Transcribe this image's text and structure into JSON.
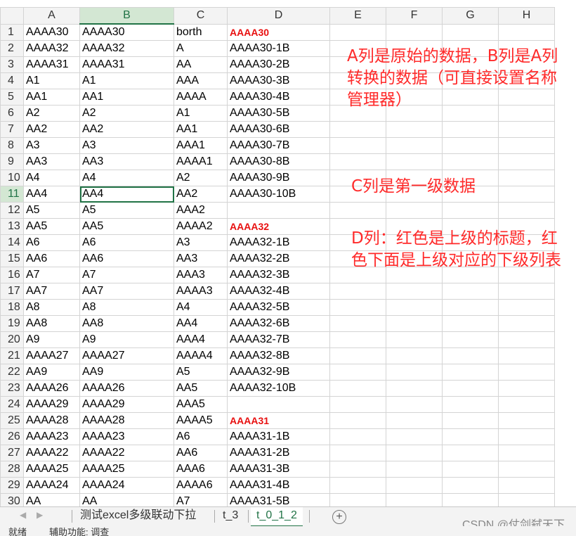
{
  "columns": [
    "A",
    "B",
    "C",
    "D",
    "E",
    "F",
    "G",
    "H"
  ],
  "rows": [
    {
      "num": "1",
      "a": "AAAA30",
      "b": "AAAA30",
      "c": "borth",
      "d": "AAAA30",
      "d_red": true
    },
    {
      "num": "2",
      "a": "AAAA32",
      "b": "AAAA32",
      "c": "A",
      "d": "AAAA30-1B"
    },
    {
      "num": "3",
      "a": "AAAA31",
      "b": "AAAA31",
      "c": "AA",
      "d": "AAAA30-2B"
    },
    {
      "num": "4",
      "a": "A1",
      "b": "A1",
      "c": "AAA",
      "d": "AAAA30-3B"
    },
    {
      "num": "5",
      "a": "AA1",
      "b": "AA1",
      "c": "AAAA",
      "d": "AAAA30-4B"
    },
    {
      "num": "6",
      "a": "A2",
      "b": "A2",
      "c": "A1",
      "d": "AAAA30-5B"
    },
    {
      "num": "7",
      "a": "AA2",
      "b": "AA2",
      "c": "AA1",
      "d": "AAAA30-6B"
    },
    {
      "num": "8",
      "a": "A3",
      "b": "A3",
      "c": "AAA1",
      "d": "AAAA30-7B"
    },
    {
      "num": "9",
      "a": "AA3",
      "b": "AA3",
      "c": "AAAA1",
      "d": "AAAA30-8B"
    },
    {
      "num": "10",
      "a": "A4",
      "b": "A4",
      "c": "A2",
      "d": "AAAA30-9B"
    },
    {
      "num": "11",
      "a": "AA4",
      "b": "AA4",
      "c": "AA2",
      "d": "AAAA30-10B",
      "active": true
    },
    {
      "num": "12",
      "a": "A5",
      "b": "A5",
      "c": "AAA2",
      "d": ""
    },
    {
      "num": "13",
      "a": "AA5",
      "b": "AA5",
      "c": "AAAA2",
      "d": "AAAA32",
      "d_red": true
    },
    {
      "num": "14",
      "a": "A6",
      "b": "A6",
      "c": "A3",
      "d": "AAAA32-1B"
    },
    {
      "num": "15",
      "a": "AA6",
      "b": "AA6",
      "c": "AA3",
      "d": "AAAA32-2B"
    },
    {
      "num": "16",
      "a": "A7",
      "b": "A7",
      "c": "AAA3",
      "d": "AAAA32-3B"
    },
    {
      "num": "17",
      "a": "AA7",
      "b": "AA7",
      "c": "AAAA3",
      "d": "AAAA32-4B"
    },
    {
      "num": "18",
      "a": "A8",
      "b": "A8",
      "c": "A4",
      "d": "AAAA32-5B"
    },
    {
      "num": "19",
      "a": "AA8",
      "b": "AA8",
      "c": "AA4",
      "d": "AAAA32-6B"
    },
    {
      "num": "20",
      "a": "A9",
      "b": "A9",
      "c": "AAA4",
      "d": "AAAA32-7B"
    },
    {
      "num": "21",
      "a": "AAAA27",
      "b": "AAAA27",
      "c": "AAAA4",
      "d": "AAAA32-8B"
    },
    {
      "num": "22",
      "a": "AA9",
      "b": "AA9",
      "c": "A5",
      "d": "AAAA32-9B"
    },
    {
      "num": "23",
      "a": "AAAA26",
      "b": "AAAA26",
      "c": "AA5",
      "d": "AAAA32-10B"
    },
    {
      "num": "24",
      "a": "AAAA29",
      "b": "AAAA29",
      "c": "AAA5",
      "d": ""
    },
    {
      "num": "25",
      "a": "AAAA28",
      "b": "AAAA28",
      "c": "AAAA5",
      "d": "AAAA31",
      "d_red": true
    },
    {
      "num": "26",
      "a": "AAAA23",
      "b": "AAAA23",
      "c": "A6",
      "d": "AAAA31-1B"
    },
    {
      "num": "27",
      "a": "AAAA22",
      "b": "AAAA22",
      "c": "AA6",
      "d": "AAAA31-2B"
    },
    {
      "num": "28",
      "a": "AAAA25",
      "b": "AAAA25",
      "c": "AAA6",
      "d": "AAAA31-3B"
    },
    {
      "num": "29",
      "a": "AAAA24",
      "b": "AAAA24",
      "c": "AAAA6",
      "d": "AAAA31-4B"
    },
    {
      "num": "30",
      "a": "AA",
      "b": "AA",
      "c": "A7",
      "d": "AAAA31-5B"
    }
  ],
  "notes": {
    "note1": "A列是原始的数据，B列是A列转换的数据（可直接设置名称管理器）",
    "note2": "C列是第一级数据",
    "note3": "D列：红色是上级的标题，红色下面是上级对应的下级列表"
  },
  "tabs": [
    "测试excel多级联动下拉",
    "t_3",
    "t_0_1_2"
  ],
  "active_tab": "t_0_1_2",
  "watermark": "CSDN @仗剑弑天下",
  "status": {
    "ready": "就绪",
    "accessibility": "辅助功能: 调查"
  },
  "colors": {
    "accent": "#217346",
    "note_red": "#ff2a2a",
    "header_red": "#e81010"
  }
}
